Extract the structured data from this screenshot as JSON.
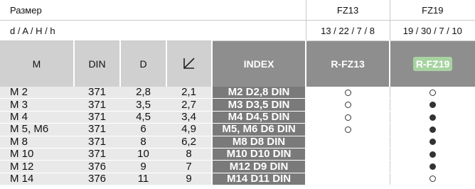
{
  "header": {
    "size_label": "Размер",
    "dims_label": "d / A / H / h",
    "fz13_title": "FZ13",
    "fz19_title": "FZ19",
    "fz13_dims": "13 / 22 / 7 / 8",
    "fz19_dims": "19 / 30 / 7 / 10"
  },
  "columns": {
    "m": "M",
    "din": "DIN",
    "d": "D",
    "thickness_icon": "diameter-slash-icon",
    "index": "INDEX",
    "rfz13": "R-FZ13",
    "rfz19": "R-FZ19"
  },
  "colors": {
    "header_grey": "#d0d0d0",
    "index_grey": "#7a7a7a",
    "row_grey": "#e9e9e9",
    "highlight_green": "#a7d3a1"
  },
  "rows": [
    {
      "m": "M 2",
      "din": "371",
      "d": "2,8",
      "t": "2,1",
      "index": "M2 D2,8 DIN",
      "fz13": "open",
      "fz19": "open"
    },
    {
      "m": "M 3",
      "din": "371",
      "d": "3,5",
      "t": "2,7",
      "index": "M3 D3,5 DIN",
      "fz13": "open",
      "fz19": "full"
    },
    {
      "m": "M 4",
      "din": "371",
      "d": "4,5",
      "t": "3,4",
      "index": "M4 D4,5 DIN",
      "fz13": "open",
      "fz19": "full"
    },
    {
      "m": "M 5, M6",
      "din": "371",
      "d": "6",
      "t": "4,9",
      "index": "M5, M6 D6 DIN",
      "fz13": "open",
      "fz19": "full"
    },
    {
      "m": "M 8",
      "din": "371",
      "d": "8",
      "t": "6,2",
      "index": "M8 D8 DIN",
      "fz13": "",
      "fz19": "full"
    },
    {
      "m": "M 10",
      "din": "371",
      "d": "10",
      "t": "8",
      "index": "M10 D10 DIN",
      "fz13": "",
      "fz19": "full"
    },
    {
      "m": "M 12",
      "din": "376",
      "d": "9",
      "t": "7",
      "index": "M12 D9 DIN",
      "fz13": "",
      "fz19": "full"
    },
    {
      "m": "M 14",
      "din": "376",
      "d": "11",
      "t": "9",
      "index": "M14 D11 DIN",
      "fz13": "",
      "fz19": "open"
    }
  ]
}
